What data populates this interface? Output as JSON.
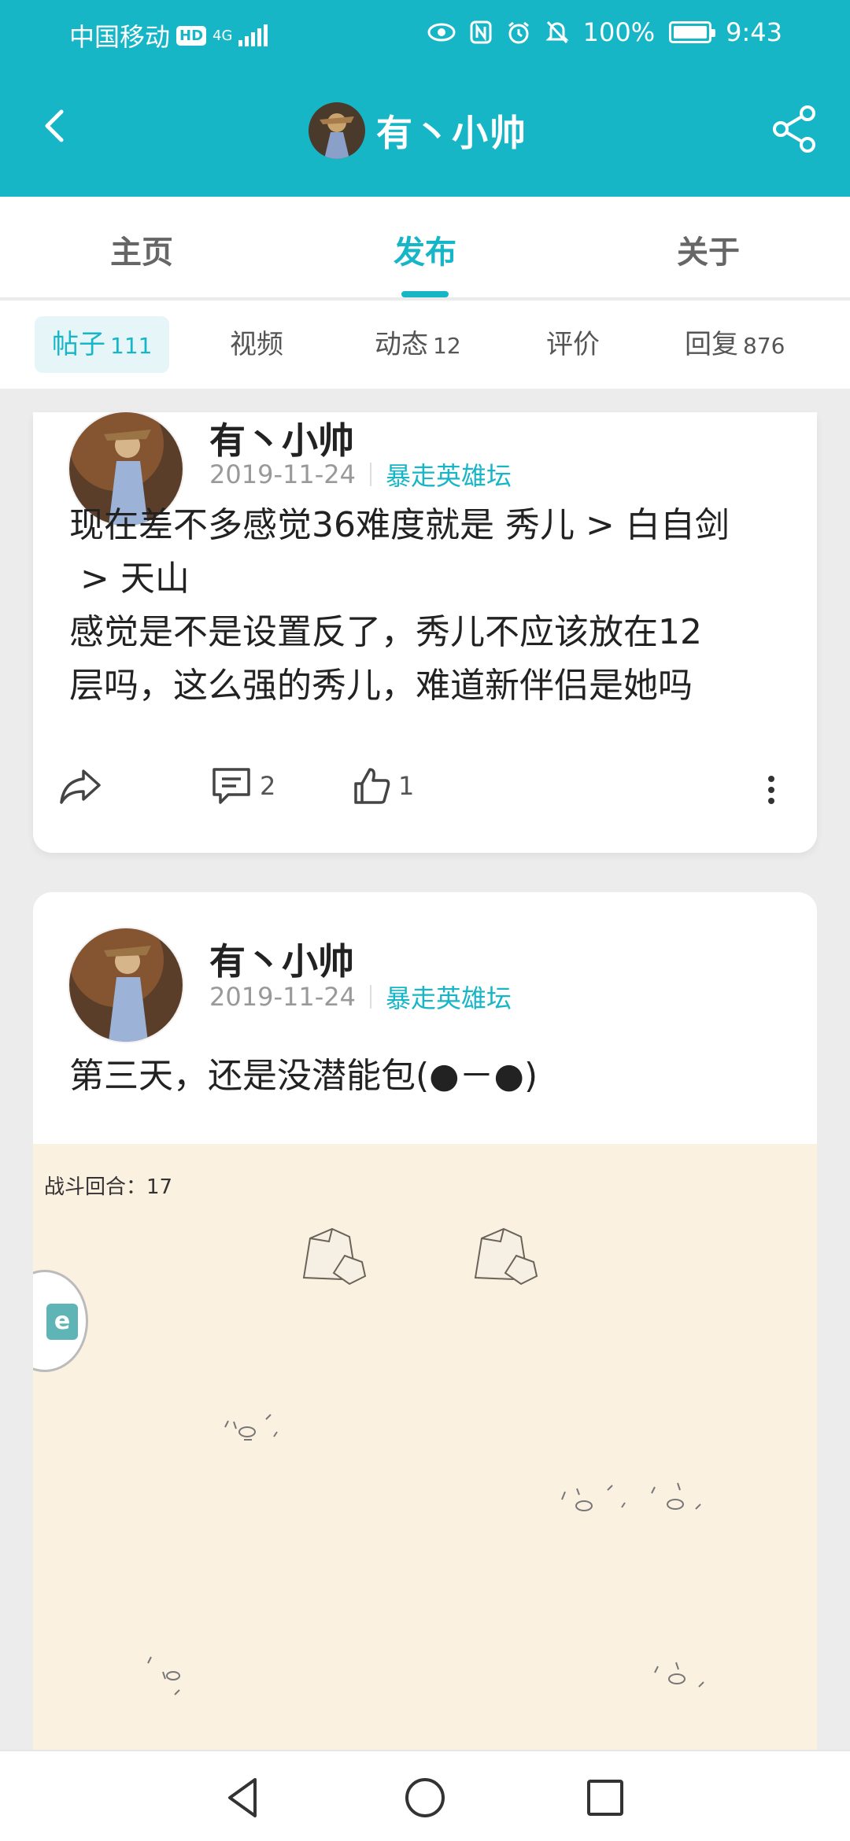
{
  "status_bar": {
    "carrier": "中国移动",
    "hd": "HD",
    "network": "4G",
    "battery": "100%",
    "battery_level": 1.0,
    "time": "9:43"
  },
  "header": {
    "title": "有丶小帅"
  },
  "tabs": [
    {
      "label": "主页"
    },
    {
      "label": "发布",
      "active": true
    },
    {
      "label": "关于"
    }
  ],
  "subtabs": [
    {
      "label": "帖子",
      "count": "111",
      "active": true
    },
    {
      "label": "视频",
      "count": ""
    },
    {
      "label": "动态",
      "count": "12"
    },
    {
      "label": "评价",
      "count": ""
    },
    {
      "label": "回复",
      "count": "876"
    }
  ],
  "posts": [
    {
      "author": "有丶小帅",
      "date": "2019-11-24",
      "board": "暴走英雄坛",
      "text_lines": [
        "现在差不多感觉36难度就是 秀儿 > 白自剑",
        " > 天山",
        "感觉是不是设置反了，秀儿不应该放在12",
        "层吗，这么强的秀儿，难道新伴侣是她吗"
      ],
      "comments": "2",
      "likes": "1"
    },
    {
      "author": "有丶小帅",
      "date": "2019-11-24",
      "board": "暴走英雄坛",
      "text_lines": [
        "第三天，还是没潜能包(●－●)"
      ],
      "image_caption": "战斗回合：17"
    }
  ],
  "colors": {
    "accent": "#17b6c6",
    "image_bg": "#fbf1e1"
  }
}
